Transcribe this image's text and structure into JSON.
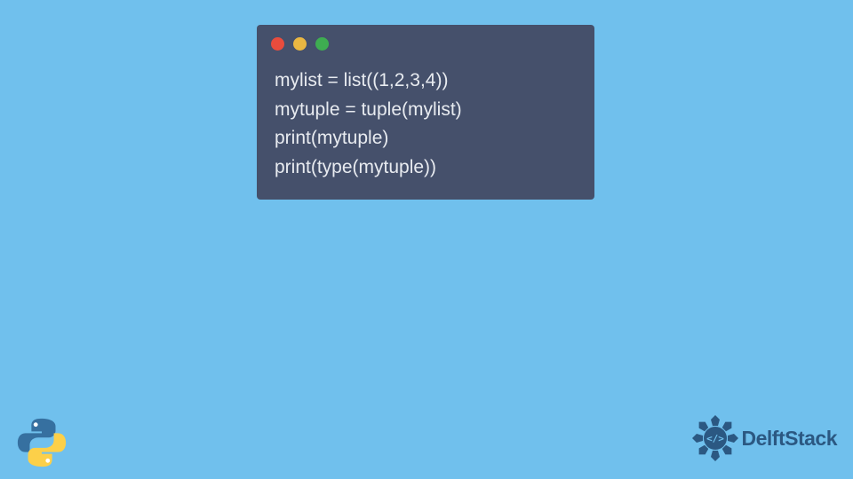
{
  "code": {
    "lines": [
      "mylist = list((1,2,3,4))",
      "mytuple = tuple(mylist)",
      "print(mytuple)",
      "print(type(mytuple))"
    ]
  },
  "branding": {
    "delft_text": "DelftStack"
  }
}
